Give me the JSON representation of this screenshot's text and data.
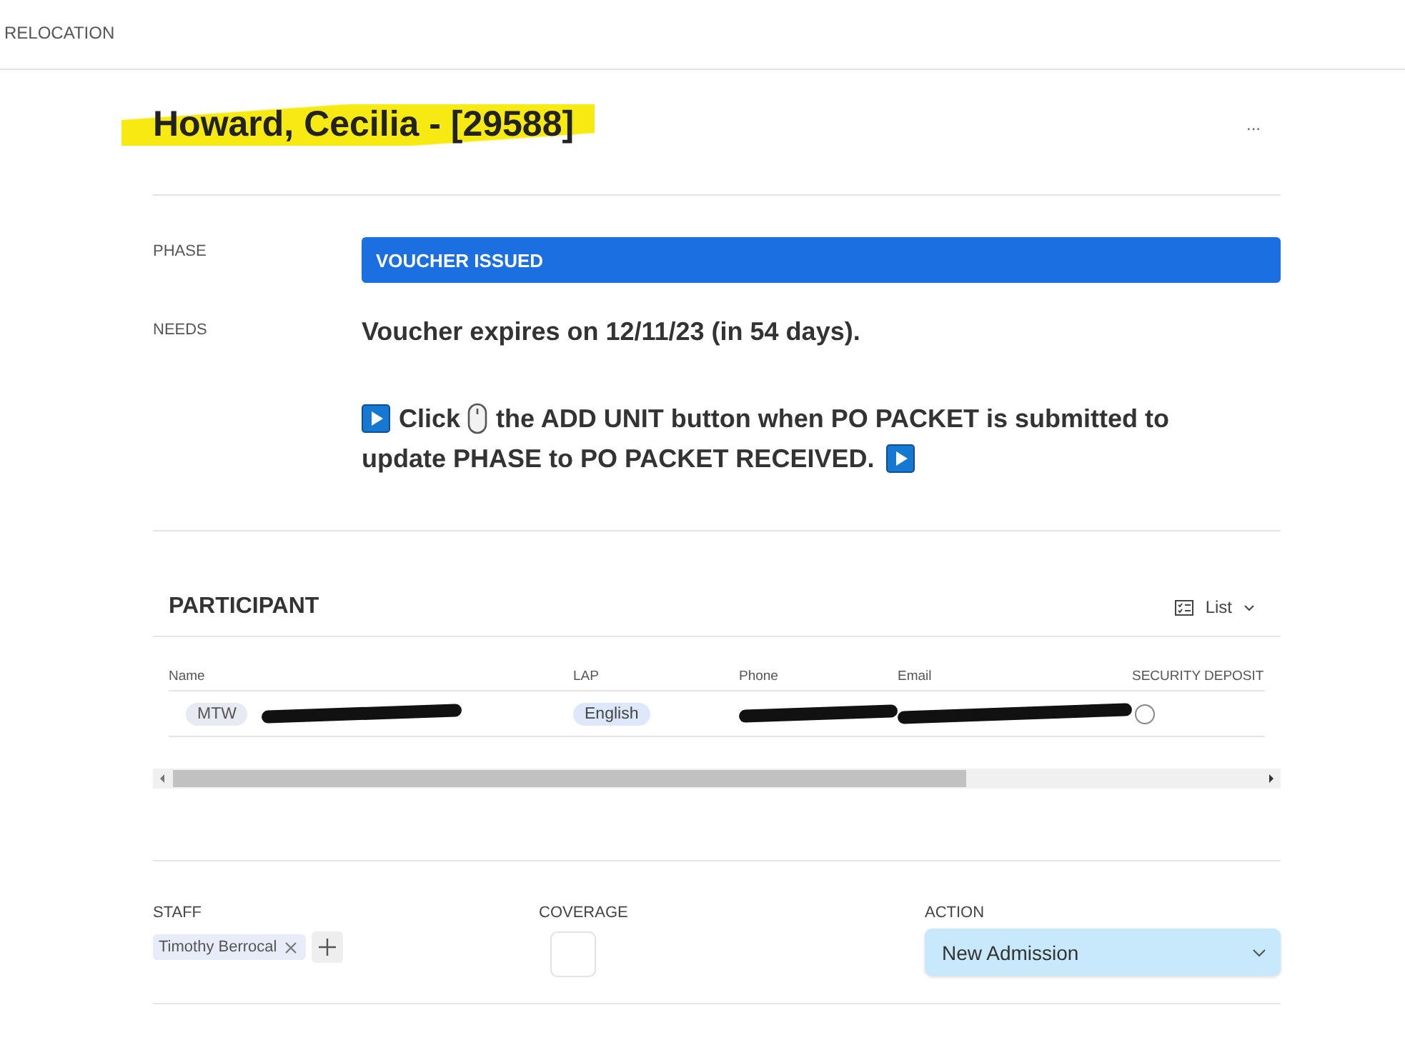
{
  "topbar": {
    "title": "RELOCATION"
  },
  "record": {
    "title": "Howard, Cecilia - [29588]",
    "highlighted": true,
    "more": "..."
  },
  "phase": {
    "label": "PHASE",
    "value": "VOUCHER ISSUED"
  },
  "needs": {
    "label": "NEEDS",
    "line": "Voucher expires on 12/11/23 (in 54 days).",
    "instruction": [
      [
        {
          "kind": "play"
        },
        {
          "kind": "text",
          "text": "Click"
        },
        {
          "kind": "mouse"
        },
        {
          "kind": "text",
          "text": "the ADD UNIT button when PO PACKET is submitted to"
        }
      ],
      [
        {
          "kind": "text",
          "text": "update PHASE to PO PACKET RECEIVED."
        },
        {
          "kind": "play"
        }
      ]
    ]
  },
  "participant": {
    "heading": "PARTICIPANT",
    "view": "List",
    "columns": [
      "Name",
      "LAP",
      "Phone",
      "Email",
      "SECURITY DEPOSIT"
    ],
    "rows": [
      {
        "tag": "MTW",
        "name_redacted": true,
        "lap": "English",
        "phone_redacted": true,
        "email_redacted": true,
        "deposit_checked": false
      }
    ]
  },
  "staff": {
    "label": "STAFF",
    "people": [
      "Timothy Berrocal"
    ]
  },
  "coverage": {
    "label": "COVERAGE",
    "checked": false
  },
  "action": {
    "label": "ACTION",
    "value": "New Admission"
  }
}
